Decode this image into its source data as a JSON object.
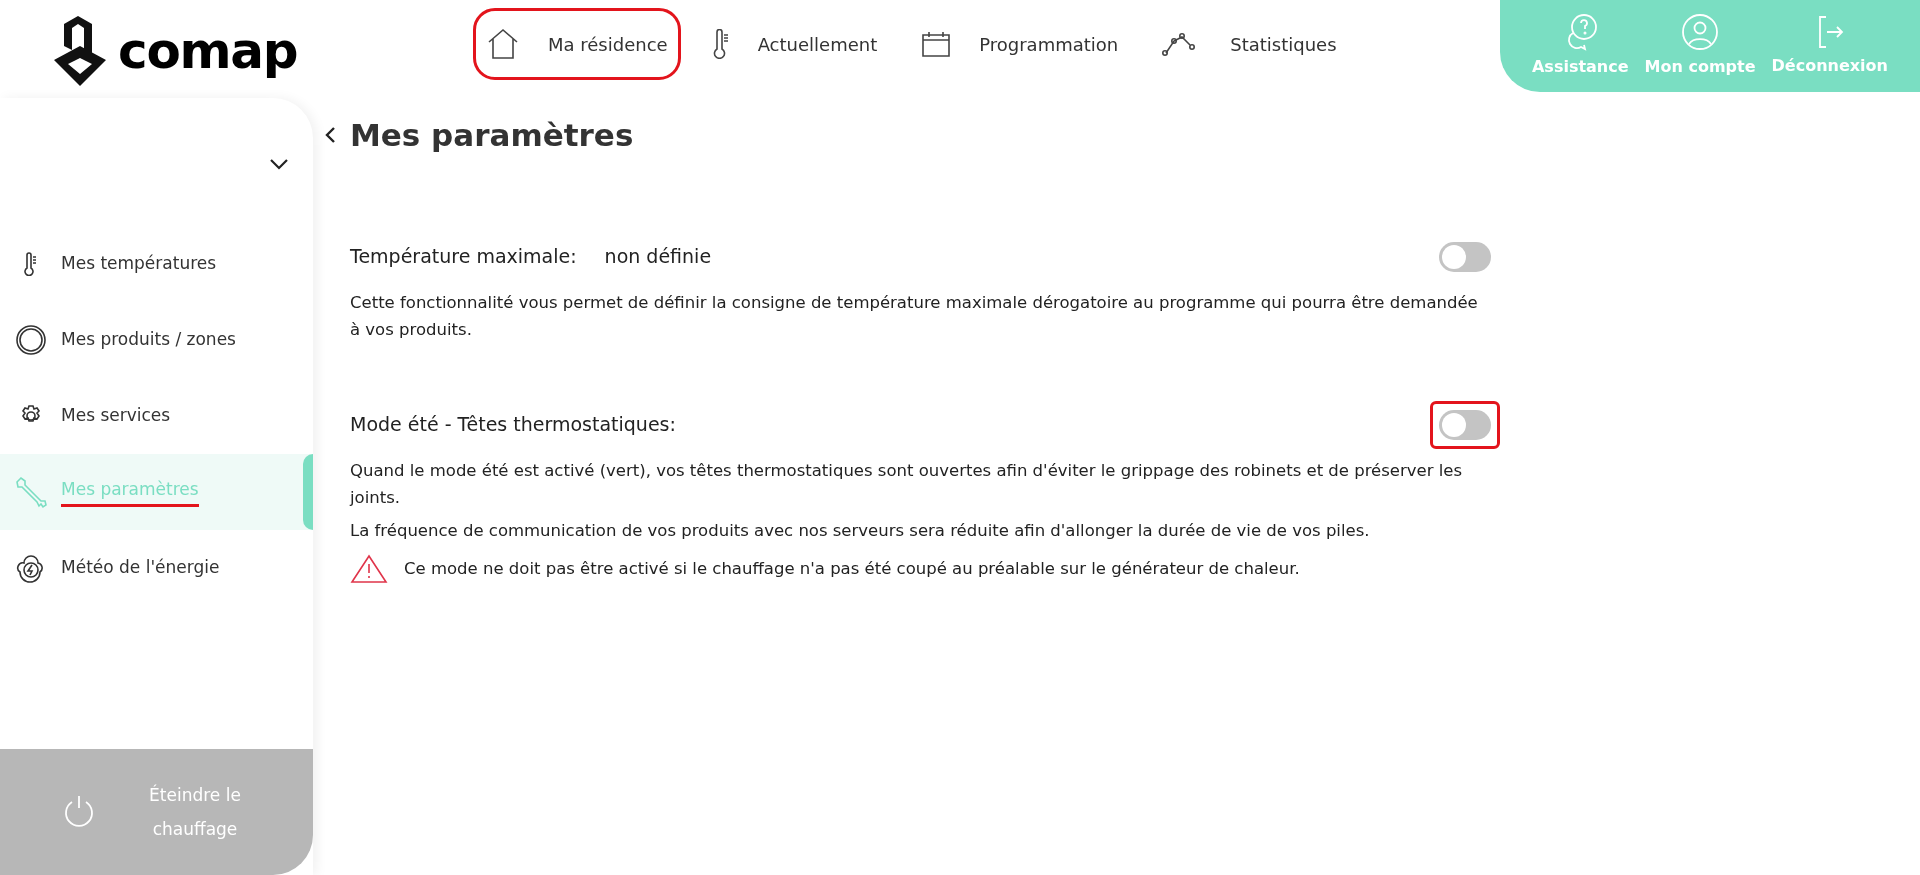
{
  "header": {
    "logo": "comap",
    "nav": [
      {
        "kind": "house",
        "label": "Ma résidence",
        "highlighted": true
      },
      {
        "kind": "thermometer",
        "label": "Actuellement",
        "highlighted": false
      },
      {
        "kind": "calendar",
        "label": "Programmation",
        "highlighted": false
      },
      {
        "kind": "stats",
        "label": "Statistiques",
        "highlighted": false
      }
    ],
    "actions": [
      {
        "kind": "help",
        "label": "Assistance"
      },
      {
        "kind": "user",
        "label": "Mon compte"
      },
      {
        "kind": "logout",
        "label": "Déconnexion"
      }
    ]
  },
  "sidebar": {
    "items": [
      {
        "kind": "thermometer",
        "label": "Mes températures",
        "selected": false,
        "highlighted": false
      },
      {
        "kind": "ring",
        "label": "Mes produits / zones",
        "selected": false,
        "highlighted": false
      },
      {
        "kind": "gear",
        "label": "Mes services",
        "selected": false,
        "highlighted": false
      },
      {
        "kind": "wrench",
        "label": "Mes paramètres",
        "selected": true,
        "highlighted": true
      },
      {
        "kind": "energy",
        "label": "Météo de l'énergie",
        "selected": false,
        "highlighted": false
      }
    ],
    "power_button": "Éteindre le chauffage"
  },
  "page": {
    "title": "Mes paramètres",
    "settings": [
      {
        "label": "Température maximale:",
        "value": "non définie",
        "on": false,
        "highlighted": false,
        "paragraphs": [
          "Cette fonctionnalité vous permet de définir la consigne de température maximale dérogatoire au programme qui pourra être demandée à vos produits."
        ]
      },
      {
        "label": "Mode été - Têtes thermostatiques:",
        "on": false,
        "highlighted": true,
        "paragraphs": [
          "Quand le mode été est activé (vert), vos têtes thermostatiques sont ouvertes afin d'éviter le grippage des robinets et de préserver les joints.",
          "La fréquence de communication de vos produits avec nos serveurs sera réduite afin d'allonger la durée de vie de vos piles."
        ],
        "warning": "Ce mode ne doit pas être activé si le chauffage n'a pas été coupé au préalable sur le générateur de chaleur."
      }
    ]
  }
}
